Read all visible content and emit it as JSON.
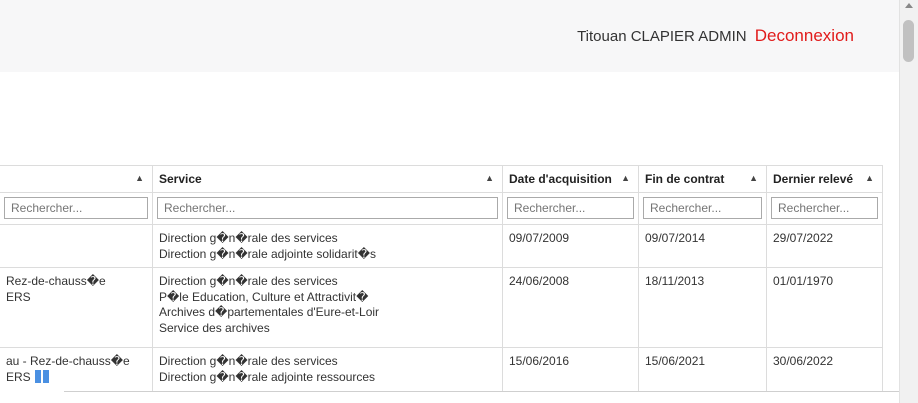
{
  "header": {
    "user": "Titouan CLAPIER ADMIN",
    "logout": "Deconnexion"
  },
  "table": {
    "columns": [
      "",
      "Service",
      "Date d'acquisition",
      "Fin de contrat",
      "Dernier relevé"
    ],
    "search_placeholder": "Rechercher...",
    "rows": [
      {
        "loc": [
          "",
          ""
        ],
        "service": [
          "Direction g�n�rale des services",
          "Direction g�n�rale adjointe solidarit�s"
        ],
        "acq": "09/07/2009",
        "fin": "09/07/2014",
        "releve": "29/07/2022"
      },
      {
        "loc": [
          "Rez-de-chauss�e",
          "ERS"
        ],
        "service": [
          "Direction g�n�rale des services",
          "P�le Education, Culture et Attractivit�",
          "Archives d�partementales d'Eure-et-Loir",
          "Service des archives"
        ],
        "acq": "24/06/2008",
        "fin": "18/11/2013",
        "releve": "01/01/1970"
      },
      {
        "loc": [
          "au - Rez-de-chauss�e",
          "ERS"
        ],
        "service": [
          "Direction g�n�rale des services",
          "Direction g�n�rale adjointe ressources"
        ],
        "acq": "15/06/2016",
        "fin": "15/06/2021",
        "releve": "30/06/2022"
      }
    ]
  },
  "icons": {
    "sort": "sort-icon",
    "book": "book-icon"
  },
  "colors": {
    "logout": "#e11b1b",
    "topbar": "#f7f7f8",
    "book": "#4a90e2"
  }
}
